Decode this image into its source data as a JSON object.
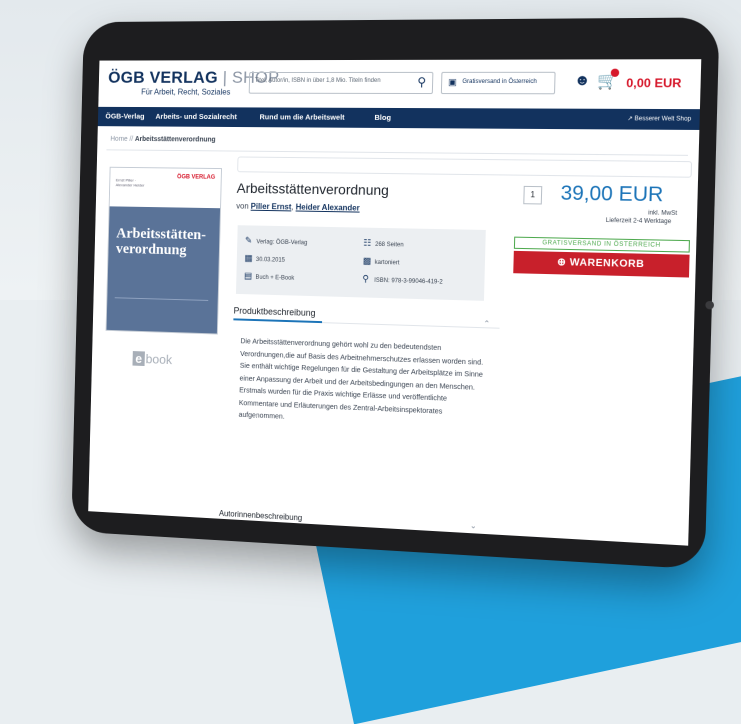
{
  "header": {
    "logo_main": "ÖGB VERLAG",
    "logo_shop": "SHOP",
    "logo_sub": "Für Arbeit, Recht, Soziales",
    "search_placeholder": "Titel, Autor/in, ISBN in über 1,8 Mio. Titeln finden",
    "shipping_label": "Gratisversand in Österreich",
    "cart_total": "0,00 EUR"
  },
  "nav": {
    "items": [
      "ÖGB-Verlag",
      "Arbeits- und Sozialrecht",
      "Rund um die Arbeitswelt",
      "Blog"
    ],
    "right": "Besserer Welt Shop"
  },
  "breadcrumb": {
    "home": "Home",
    "separator": "//",
    "current": "Arbeitsstättenverordnung"
  },
  "cover": {
    "publisher": "ÖGB VERLAG",
    "title_line1": "Arbeitsstätten-",
    "title_line2": "verordnung",
    "small_text": "Ernst Piller · Alexander Heider"
  },
  "ebook_label": "book",
  "product": {
    "title": "Arbeitsstättenverordnung",
    "by": "von",
    "author1": "Piller Ernst",
    "author_sep": ",",
    "author2": "Heider Alexander",
    "meta": {
      "publisher": "Verlag: ÖGB-Verlag",
      "date": "30.03.2015",
      "format": "Buch + E-Book",
      "pages": "268 Seiten",
      "binding": "kartoniert",
      "isbn": "ISBN: 978-3-99046-419-2"
    }
  },
  "price_box": {
    "quantity": "1",
    "price": "39,00 EUR",
    "vat": "inkl. MwSt",
    "delivery": "Lieferzeit 2-4 Werktage",
    "free_shipping": "GRATISVERSAND IN ÖSTERREICH",
    "cart_button": "WARENKORB"
  },
  "description": {
    "heading": "Produktbeschreibung",
    "text": "Die Arbeitsstättenverordnung gehört wohl zu den bedeutendsten Verordnungen,die auf Basis des Arbeitnehmerschutzes erlassen worden sind. Sie enthält wichtige Regelungen für die Gestaltung der Arbeitsplätze im Sinne einer Anpassung der Arbeit und der Arbeitsbedingungen an den Menschen. Erstmals wurden für die Praxis wichtige Erlässe und veröffentlichte Kommentare und Erläuterungen des Zentral-Arbeitsinspektorates aufgenommen.",
    "heading2": "Autorinnenbeschreibung"
  },
  "colors": {
    "navy": "#12325e",
    "red": "#c8202b",
    "price_blue": "#1c74b8",
    "green": "#4ea94e"
  }
}
